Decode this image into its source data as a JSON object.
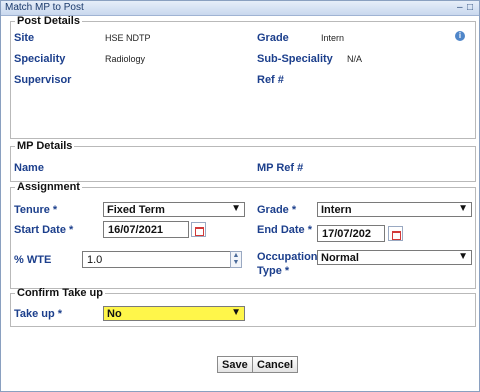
{
  "window": {
    "title": "Match MP to Post",
    "minimize": "–",
    "maximize": "□"
  },
  "post_details": {
    "legend": "Post Details",
    "site_label": "Site",
    "site_value": "HSE NDTP",
    "grade_label": "Grade",
    "grade_value": "Intern",
    "speciality_label": "Speciality",
    "speciality_value": "Radiology",
    "subspeciality_label": "Sub-Speciality",
    "subspeciality_value": "N/A",
    "supervisor_label": "Supervisor",
    "ref_label": "Ref #"
  },
  "mp_details": {
    "legend": "MP Details",
    "name_label": "Name",
    "mp_ref_label": "MP Ref #"
  },
  "assignment": {
    "legend": "Assignment",
    "tenure_label": "Tenure *",
    "tenure_value": "Fixed Term",
    "grade_label": "Grade *",
    "grade_value": "Intern",
    "start_label": "Start Date *",
    "start_value": "16/07/2021",
    "end_label": "End Date *",
    "end_value": "17/07/202",
    "wte_label": "% WTE",
    "wte_value": "1.0",
    "occupation_label_1": "Occupation",
    "occupation_label_2": "Type *",
    "occupation_value": "Normal"
  },
  "confirm": {
    "legend": "Confirm Take up",
    "takeup_label": "Take up *",
    "takeup_value": "No"
  },
  "buttons": {
    "save": "Save",
    "cancel": "Cancel"
  },
  "icons": {
    "info": "info-icon",
    "calendar": "calendar-icon",
    "dropdown": "chevron-down-icon"
  }
}
